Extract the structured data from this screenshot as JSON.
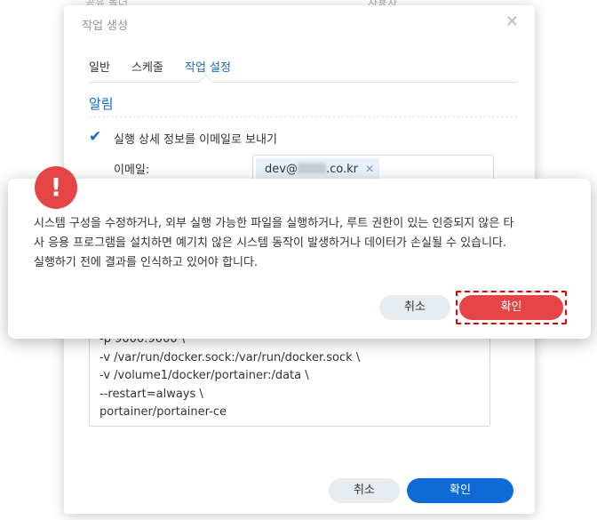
{
  "background": {
    "label_left": "공유 폴더",
    "label_right": "사용자"
  },
  "dialog": {
    "title": "작업 생성",
    "tabs": [
      {
        "label": "일반"
      },
      {
        "label": "스케줄"
      },
      {
        "label": "작업 설정"
      }
    ],
    "section_title": "알림",
    "send_email_label": "실행 상세 정보를 이메일로 보내기",
    "send_email_checked": true,
    "email_label": "이메일:",
    "email_prefix": "dev@",
    "email_suffix": ".co.kr",
    "code_lines": [
      "-p 9000:9000 \\",
      "-v /var/run/docker.sock:/var/run/docker.sock \\",
      "-v /volume1/docker/portainer:/data \\",
      "--restart=always \\",
      "portainer/portainer-ce"
    ],
    "cancel_label": "취소",
    "ok_label": "확인"
  },
  "alert": {
    "icon": "!",
    "lines": [
      "시스템 구성을 수정하거나, 외부 실행 가능한 파일을 실행하거나, 루트 권한이 있는 인증되지 않은 타",
      "사 응용 프로그램을 설치하면 예기치 않은 시스템 동작이 발생하거나 데이터가 손실될 수 있습니다.",
      "실행하기 전에 결과를 인식하고 있어야 합니다."
    ],
    "cancel_label": "취소",
    "ok_label": "확인"
  },
  "colors": {
    "accent": "#0d6ad6",
    "danger": "#e64545",
    "focus": "#e00000"
  }
}
